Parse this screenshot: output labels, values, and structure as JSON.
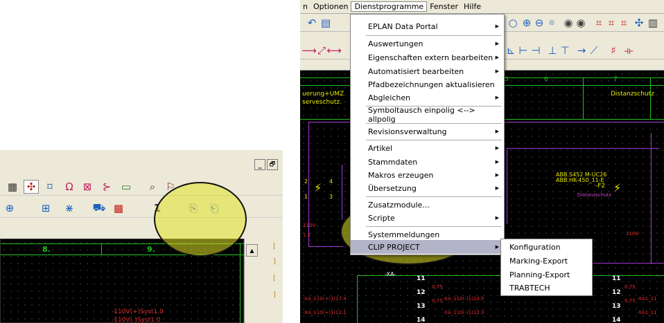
{
  "left_panel": {
    "window_controls": [
      "_",
      "🗗"
    ],
    "ruler": [
      "8.",
      "9."
    ],
    "wire_labels": [
      "-110V(+)Syst1.0",
      "-110V(-)Syst1.0"
    ]
  },
  "menubar": {
    "items": [
      "n",
      "Optionen",
      "Dienstprogramme",
      "Fenster",
      "Hilfe"
    ]
  },
  "menu": {
    "items": [
      {
        "label": "EPLAN Data Portal",
        "submenu": true
      },
      {
        "label": "Auswertungen",
        "submenu": true
      },
      {
        "label": "Eigenschaften extern bearbeiten",
        "submenu": true
      },
      {
        "label": "Automatisiert bearbeiten",
        "submenu": true
      },
      {
        "label": "Pfadbezeichnungen aktualisieren",
        "submenu": false
      },
      {
        "label": "Abgleichen",
        "submenu": true
      },
      {
        "label": "Symboltausch einpolig <--> allpolig",
        "submenu": false
      },
      {
        "label": "Revisionsverwaltung",
        "submenu": true
      },
      {
        "label": "Artikel",
        "submenu": true
      },
      {
        "label": "Stammdaten",
        "submenu": true
      },
      {
        "label": "Makros erzeugen",
        "submenu": true
      },
      {
        "label": "Übersetzung",
        "submenu": true
      },
      {
        "label": "Zusatzmodule...",
        "submenu": false
      },
      {
        "label": "Scripte",
        "submenu": true
      },
      {
        "label": "Systemmeldungen",
        "submenu": false
      },
      {
        "label": "CLIP PROJECT",
        "submenu": true
      }
    ]
  },
  "submenu": {
    "items": [
      "Konfiguration",
      "Marking-Export",
      "Planning-Export",
      "TRABTECH"
    ]
  },
  "canvas": {
    "ruler": [
      "5",
      "6",
      "7"
    ],
    "title_left": "uerung+UMZ",
    "title_left2": "serveschutz.",
    "title_right": "Distanzschutz",
    "device_label1": "ABB.S452 M-UC26",
    "device_label2": "ABB.HK-450_11-E",
    "device_tag": "-F2",
    "device_sub": "Distanzschutz",
    "xa_label": "-XA-",
    "terminals": [
      "11",
      "12",
      "13",
      "14",
      "11",
      "12",
      "13",
      "14"
    ],
    "wires": [
      "-XA_110(+)1(17.4",
      "-XA_110(-)1(14.5",
      "-XA_110(-)1(12.3",
      "-XA_110(+)1(12.1",
      "-XA1_11",
      "-XA1_11"
    ],
    "small_labels": [
      "110V-",
      "2",
      "5",
      "1.5",
      "1",
      "3",
      "4"
    ],
    "values": [
      "0.75",
      "0.75",
      "0.75",
      "0.75"
    ]
  },
  "colors": {
    "accent_highlight": "#b4b4c8",
    "canvas": "#000000",
    "grid_green": "#1fc21f",
    "wire_magenta": "#a23ad8",
    "ellipse_fill": "#e1e128"
  }
}
